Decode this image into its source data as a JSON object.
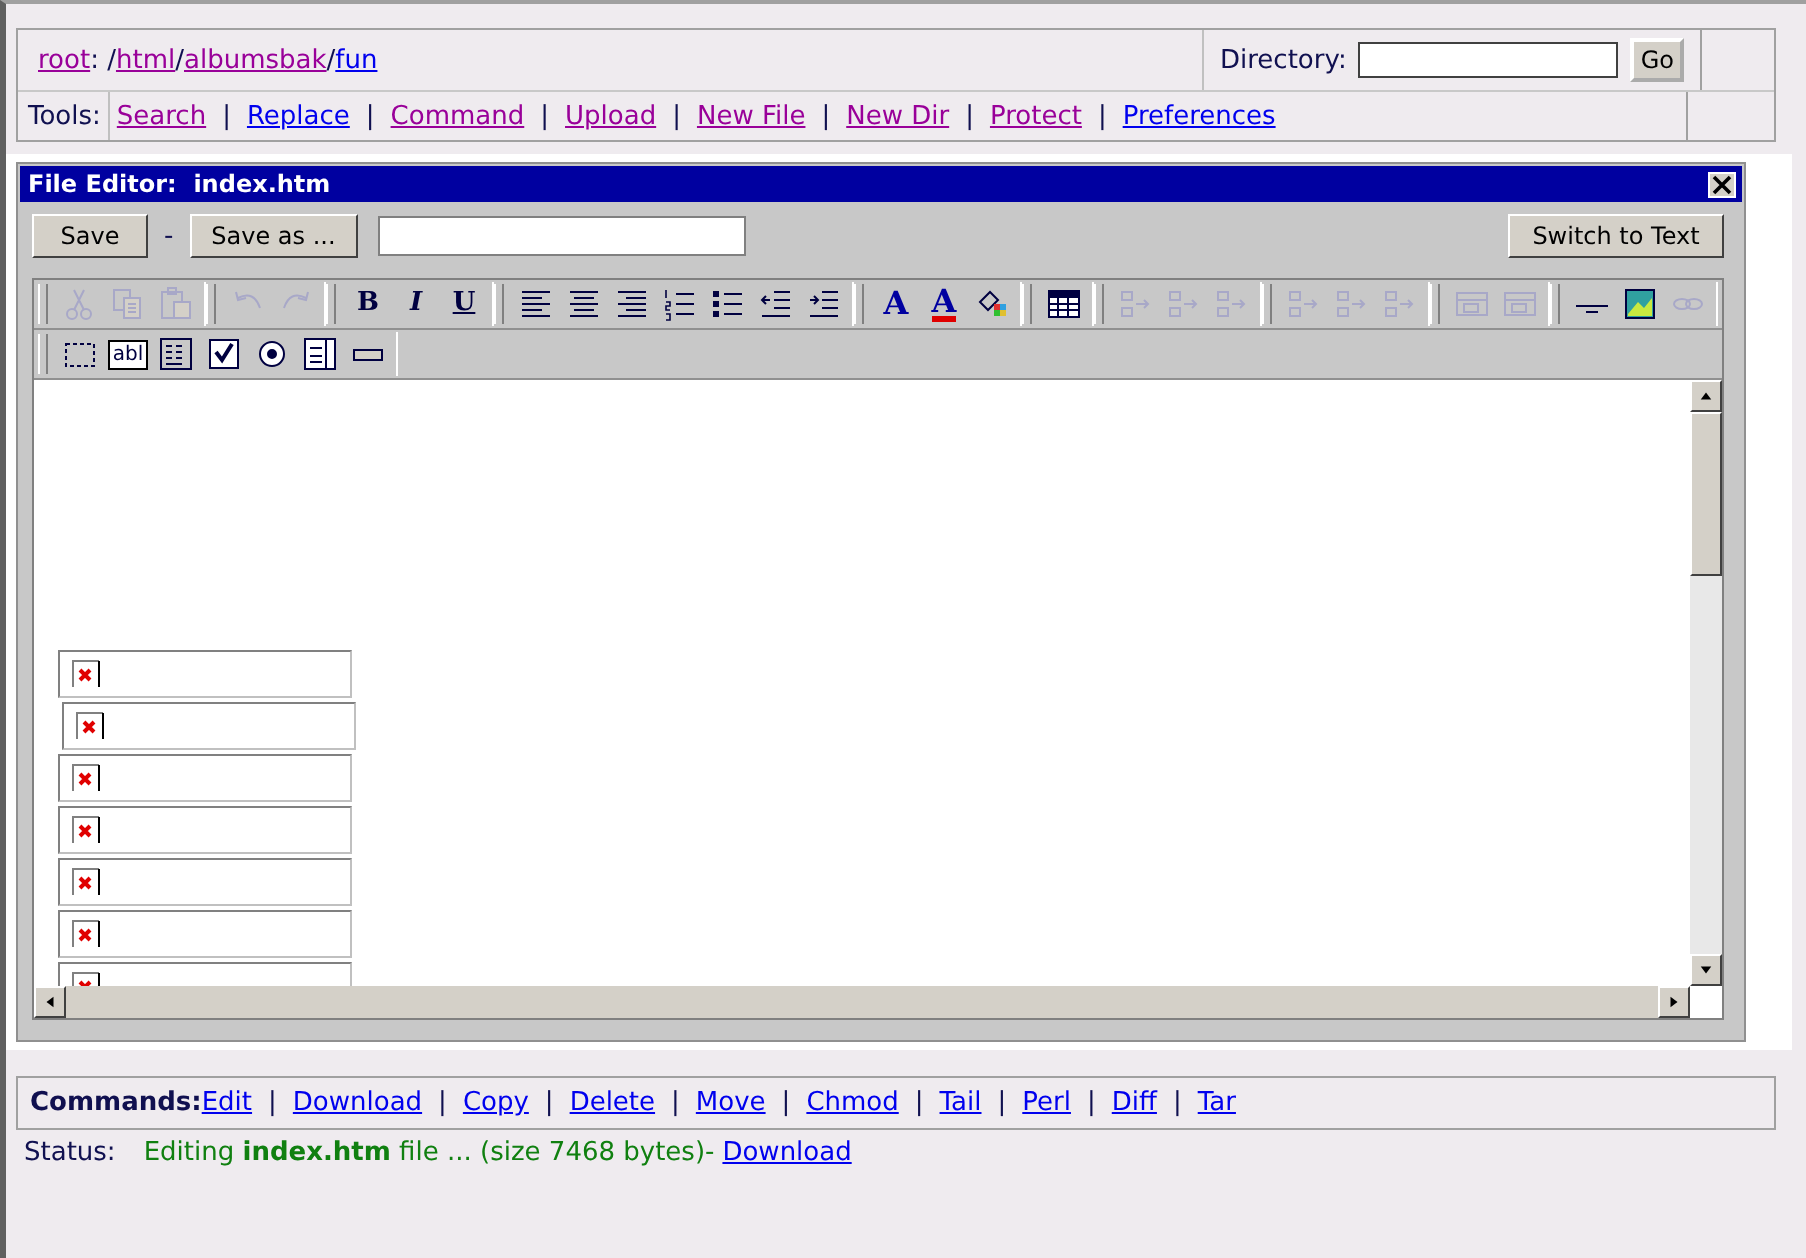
{
  "location": {
    "segments": [
      {
        "kind": "link",
        "text": "root",
        "visited": true
      },
      {
        "kind": "text",
        "text": ": /"
      },
      {
        "kind": "link",
        "text": "html",
        "visited": true
      },
      {
        "kind": "text",
        "text": "/"
      },
      {
        "kind": "link",
        "text": "albumsbak",
        "visited": true
      },
      {
        "kind": "text",
        "text": "/"
      },
      {
        "kind": "link",
        "text": "fun",
        "visited": false
      }
    ],
    "directory_label": "Directory:",
    "go_button": "Go"
  },
  "tools": {
    "label": "Tools:",
    "separator": "|",
    "links": [
      {
        "text": "Search",
        "visited": true
      },
      {
        "text": "Replace",
        "visited": false
      },
      {
        "text": "Command",
        "visited": true
      },
      {
        "text": "Upload",
        "visited": true
      },
      {
        "text": "New File",
        "visited": true
      },
      {
        "text": "New Dir",
        "visited": true
      },
      {
        "text": "Protect",
        "visited": true
      },
      {
        "text": "Preferences",
        "visited": false
      }
    ]
  },
  "editor_window": {
    "title": "File Editor:  index.htm",
    "save_button": "Save",
    "dash": "-",
    "save_as_button": "Save as ...",
    "switch_button": "Switch to Text",
    "toolbar_rows": [
      [
        [
          {
            "kind": "cut",
            "disabled": true
          },
          {
            "kind": "copy",
            "disabled": true
          },
          {
            "kind": "paste",
            "disabled": true
          }
        ],
        [
          {
            "kind": "undo",
            "disabled": true
          },
          {
            "kind": "redo",
            "disabled": true
          }
        ],
        [
          {
            "kind": "bold",
            "glyph": "B",
            "disabled": false
          },
          {
            "kind": "italic",
            "glyph": "I",
            "disabled": false
          },
          {
            "kind": "underline",
            "glyph": "U",
            "disabled": false
          }
        ],
        [
          {
            "kind": "align-left",
            "disabled": false
          },
          {
            "kind": "align-center",
            "disabled": false
          },
          {
            "kind": "align-right",
            "disabled": false
          },
          {
            "kind": "ordered-list",
            "disabled": false
          },
          {
            "kind": "bullet-list",
            "disabled": false
          },
          {
            "kind": "outdent",
            "disabled": false
          },
          {
            "kind": "indent",
            "disabled": false
          }
        ],
        [
          {
            "kind": "font-color",
            "glyph": "A",
            "disabled": false
          },
          {
            "kind": "highlight",
            "glyph": "A",
            "disabled": false
          },
          {
            "kind": "fill",
            "disabled": false
          }
        ],
        [
          {
            "kind": "table",
            "disabled": false
          }
        ],
        [
          {
            "kind": "column-before",
            "disabled": true
          },
          {
            "kind": "column-after",
            "disabled": true
          },
          {
            "kind": "column-delete",
            "disabled": true
          }
        ],
        [
          {
            "kind": "row-before",
            "disabled": true
          },
          {
            "kind": "row-after",
            "disabled": true
          },
          {
            "kind": "row-delete",
            "disabled": true
          }
        ],
        [
          {
            "kind": "merge",
            "disabled": true
          },
          {
            "kind": "split",
            "disabled": true
          }
        ],
        [
          {
            "kind": "rule",
            "disabled": false
          },
          {
            "kind": "image",
            "disabled": false
          },
          {
            "kind": "link",
            "disabled": true
          }
        ]
      ],
      [
        [
          {
            "kind": "form",
            "disabled": false
          },
          {
            "kind": "text-field",
            "glyph": "abl",
            "disabled": false
          },
          {
            "kind": "text-area",
            "disabled": false
          },
          {
            "kind": "checkbox",
            "disabled": false
          },
          {
            "kind": "radio",
            "disabled": false
          },
          {
            "kind": "select",
            "disabled": false
          },
          {
            "kind": "push-button",
            "disabled": false
          }
        ]
      ]
    ],
    "content": [
      {
        "kind": "broken-image"
      },
      {
        "kind": "broken-image"
      },
      {
        "kind": "broken-image"
      },
      {
        "kind": "broken-image"
      },
      {
        "kind": "broken-image"
      },
      {
        "kind": "broken-image"
      },
      {
        "kind": "broken-image"
      }
    ]
  },
  "commands": {
    "label": "Commands:",
    "separator": "|",
    "links": [
      {
        "text": "Edit",
        "visited": false
      },
      {
        "text": "Download",
        "visited": false
      },
      {
        "text": "Copy",
        "visited": false
      },
      {
        "text": "Delete",
        "visited": false
      },
      {
        "text": "Move",
        "visited": false
      },
      {
        "text": "Chmod",
        "visited": false
      },
      {
        "text": "Tail",
        "visited": false
      },
      {
        "text": "Perl",
        "visited": false
      },
      {
        "text": "Diff",
        "visited": false
      },
      {
        "text": "Tar",
        "visited": false
      }
    ]
  },
  "status": {
    "label": "Status:",
    "message": "Editing **index.htm** file ... (size 7468 bytes)-",
    "link": {
      "text": "Download",
      "visited": false
    }
  }
}
